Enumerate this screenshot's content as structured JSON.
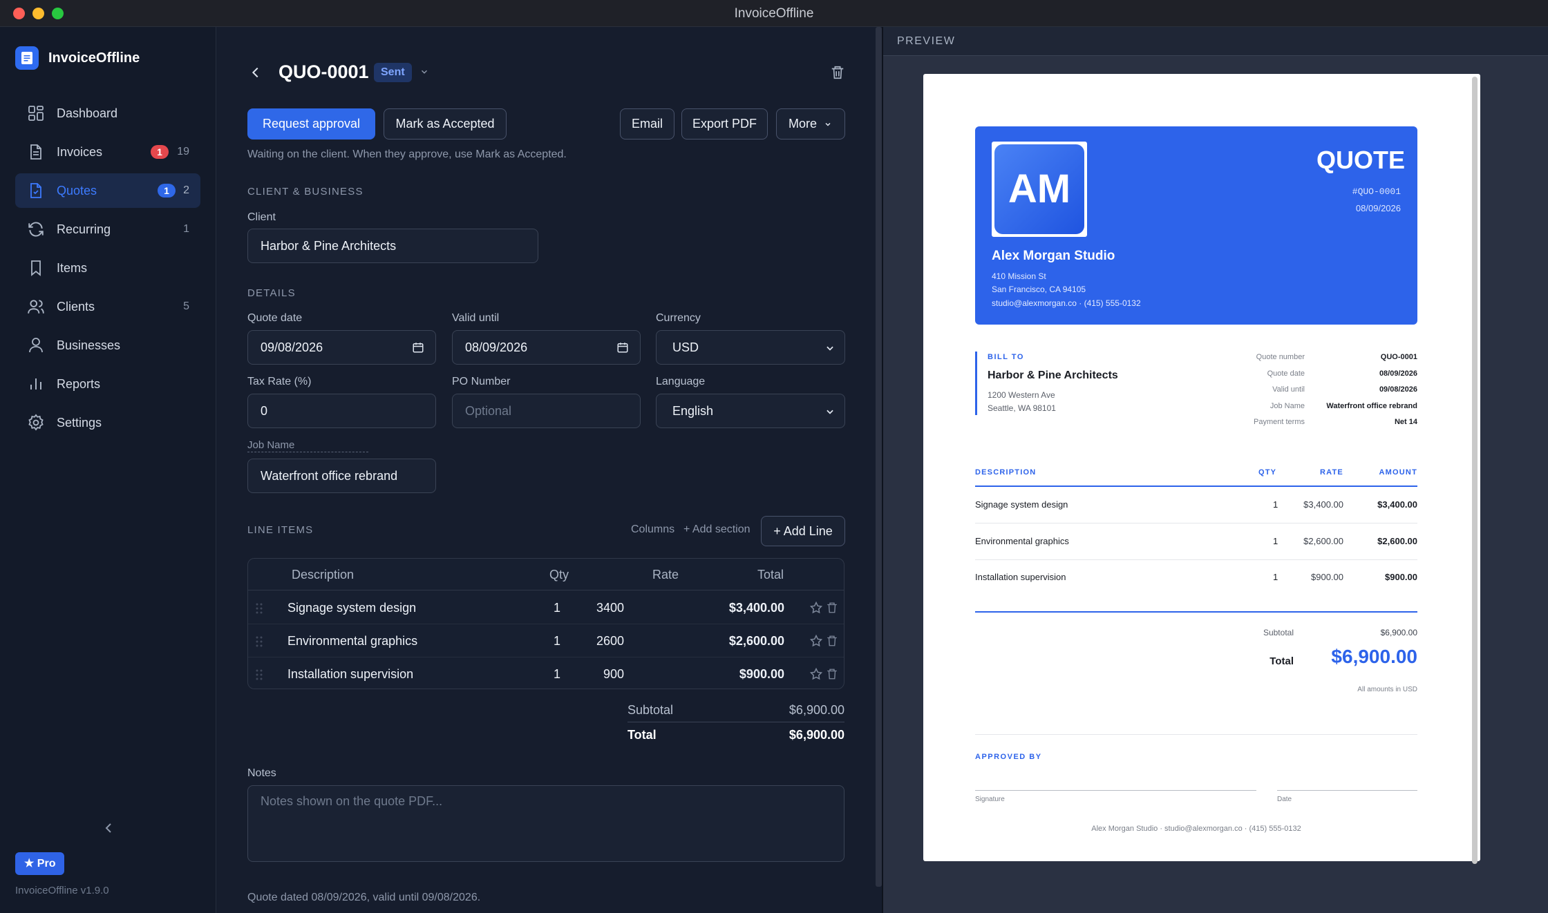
{
  "window": {
    "title": "InvoiceOffline"
  },
  "sidebar": {
    "brand": "InvoiceOffline",
    "items": [
      {
        "label": "Dashboard",
        "icon": "grid-icon",
        "count": "",
        "badge": ""
      },
      {
        "label": "Invoices",
        "icon": "document-icon",
        "count": "19",
        "badge": "1",
        "badge_color": "#e5484d"
      },
      {
        "label": "Quotes",
        "icon": "quote-document-icon",
        "count": "2",
        "badge": "1",
        "badge_color": "#2f68e8",
        "active": true
      },
      {
        "label": "Recurring",
        "icon": "refresh-icon",
        "count": "1",
        "badge": ""
      },
      {
        "label": "Items",
        "icon": "bookmark-icon",
        "count": "",
        "badge": ""
      },
      {
        "label": "Clients",
        "icon": "users-icon",
        "count": "5",
        "badge": ""
      },
      {
        "label": "Businesses",
        "icon": "user-icon",
        "count": "",
        "badge": ""
      },
      {
        "label": "Reports",
        "icon": "bar-chart-icon",
        "count": "",
        "badge": ""
      },
      {
        "label": "Settings",
        "icon": "gear-icon",
        "count": "",
        "badge": ""
      }
    ],
    "pro_label": "★ Pro",
    "version": "InvoiceOffline v1.9.0"
  },
  "header": {
    "quote_id": "QUO-0001",
    "status": "Sent"
  },
  "actions": {
    "request_approval": "Request approval",
    "mark_accepted": "Mark as Accepted",
    "email": "Email",
    "export_pdf": "Export PDF",
    "more": "More",
    "hint": "Waiting on the client. When they approve, use Mark as Accepted."
  },
  "client_section": {
    "title": "CLIENT & BUSINESS",
    "client_label": "Client",
    "client_value": "Harbor & Pine Architects"
  },
  "details": {
    "title": "DETAILS",
    "quote_date_label": "Quote date",
    "quote_date": "09/08/2026",
    "valid_until_label": "Valid until",
    "valid_until": "08/09/2026",
    "currency_label": "Currency",
    "currency": "USD",
    "tax_label": "Tax Rate (%)",
    "tax": "0",
    "po_label": "PO Number",
    "po_placeholder": "Optional",
    "language_label": "Language",
    "language": "English",
    "job_label": "Job Name",
    "job": "Waterfront office rebrand"
  },
  "line_items": {
    "title": "LINE ITEMS",
    "columns_link": "Columns",
    "add_section": "+ Add section",
    "add_line": "+ Add Line",
    "headers": {
      "description": "Description",
      "qty": "Qty",
      "rate": "Rate",
      "total": "Total"
    },
    "rows": [
      {
        "description": "Signage system design",
        "qty": "1",
        "rate": "3400",
        "total": "$3,400.00"
      },
      {
        "description": "Environmental graphics",
        "qty": "1",
        "rate": "2600",
        "total": "$2,600.00"
      },
      {
        "description": "Installation supervision",
        "qty": "1",
        "rate": "900",
        "total": "$900.00"
      }
    ],
    "subtotal_label": "Subtotal",
    "subtotal": "$6,900.00",
    "total_label": "Total",
    "total": "$6,900.00"
  },
  "notes": {
    "label": "Notes",
    "placeholder": "Notes shown on the quote PDF..."
  },
  "footer_text": "Quote dated 08/09/2026, valid until 09/08/2026.",
  "preview": {
    "title": "PREVIEW",
    "doc_title": "QUOTE",
    "doc_number": "#QUO-0001",
    "doc_date": "08/09/2026",
    "logo_initials": "AM",
    "business_name": "Alex Morgan Studio",
    "business_address1": "410 Mission St",
    "business_address2": "San Francisco, CA 94105",
    "business_contact": "studio@alexmorgan.co · (415) 555-0132",
    "bill_to_label": "BILL TO",
    "client_name": "Harbor & Pine Architects",
    "client_address1": "1200 Western Ave",
    "client_address2": "Seattle, WA 98101",
    "meta": [
      {
        "label": "Quote number",
        "value": "QUO-0001"
      },
      {
        "label": "Quote date",
        "value": "08/09/2026"
      },
      {
        "label": "Valid until",
        "value": "09/08/2026"
      },
      {
        "label": "Job Name",
        "value": "Waterfront office rebrand"
      },
      {
        "label": "Payment terms",
        "value": "Net 14"
      }
    ],
    "col_description": "DESCRIPTION",
    "col_qty": "QTY",
    "col_rate": "RATE",
    "col_amount": "AMOUNT",
    "rows": [
      {
        "description": "Signage system design",
        "qty": "1",
        "rate": "$3,400.00",
        "amount": "$3,400.00"
      },
      {
        "description": "Environmental graphics",
        "qty": "1",
        "rate": "$2,600.00",
        "amount": "$2,600.00"
      },
      {
        "description": "Installation supervision",
        "qty": "1",
        "rate": "$900.00",
        "amount": "$900.00"
      }
    ],
    "subtotal_label": "Subtotal",
    "subtotal": "$6,900.00",
    "total_label": "Total",
    "total": "$6,900.00",
    "currency_note": "All amounts in USD",
    "approved_by": "APPROVED BY",
    "signature_label": "Signature",
    "date_label": "Date",
    "footer": "Alex Morgan Studio · studio@alexmorgan.co · (415) 555-0132"
  },
  "colors": {
    "accent": "#2f68e8",
    "sidebar_bg": "#131a29",
    "main_bg": "#161d2d",
    "danger_badge": "#e5484d"
  }
}
